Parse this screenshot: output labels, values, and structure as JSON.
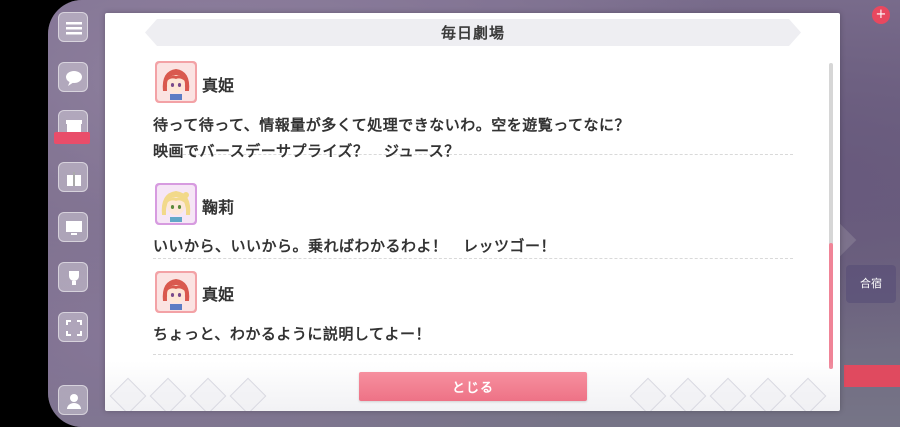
{
  "dialog": {
    "title": "毎日劇場",
    "close_label": "とじる"
  },
  "entries": [
    {
      "speaker": "真姫",
      "avatar": "maki-avatar",
      "lines": [
        "待って待って、情報量が多くて処理できないわ。空を遊覧ってなに？",
        "映画でバースデーサプライズ？　ジュース？"
      ]
    },
    {
      "speaker": "鞠莉",
      "avatar": "mari-avatar",
      "lines": [
        "いいから、いいから。乗ればわかるわよ！　レッツゴー！"
      ]
    },
    {
      "speaker": "真姫",
      "avatar": "maki-avatar",
      "lines": [
        "ちょっと、わかるように説明してよー！"
      ]
    }
  ],
  "background": {
    "right_badge": "+",
    "right_card": "合宿"
  },
  "colors": {
    "accent": "#ee7286",
    "scroll_thumb": "#f08497",
    "maki_hair": "#d9594e",
    "mari_hair": "#f2d98a"
  }
}
